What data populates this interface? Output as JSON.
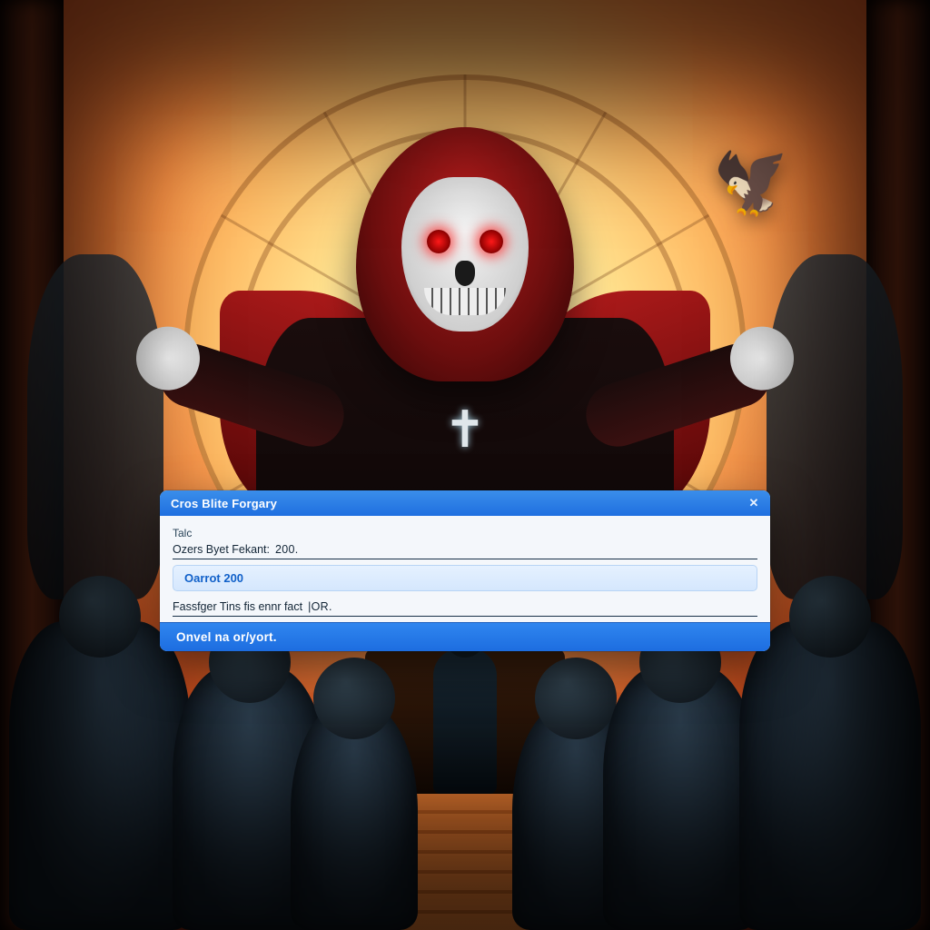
{
  "scene": {
    "bird_glyph": "🦅",
    "pendant_glyph": "✝"
  },
  "dialog": {
    "title": "Cros Blite Forgary",
    "close_glyph": "✕",
    "label_title": "Talc",
    "field1_label": "Ozers Byet Fekant:",
    "field1_value": "200.",
    "pill_label": "Oarrot 200",
    "field2_label": "Fassfger Tins fis ennr fact",
    "field2_value": "|OR.",
    "primary_label": "Onvel na or/yort."
  }
}
